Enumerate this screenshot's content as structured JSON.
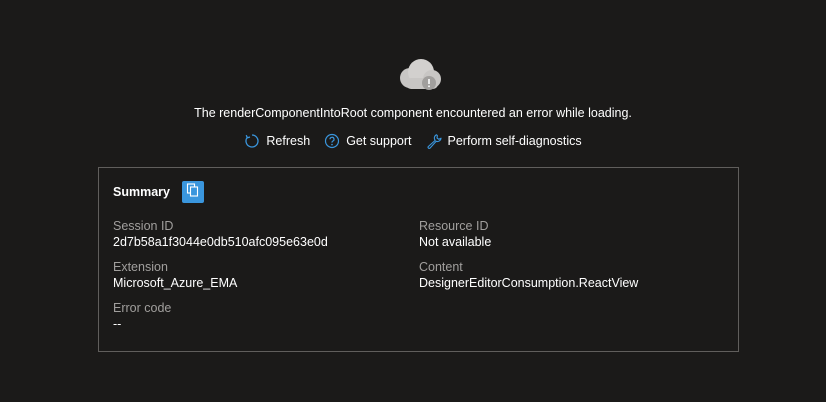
{
  "error": {
    "message": "The renderComponentIntoRoot component encountered an error while loading."
  },
  "actions": {
    "refresh_label": "Refresh",
    "support_label": "Get support",
    "diagnostics_label": "Perform self-diagnostics"
  },
  "summary": {
    "title": "Summary",
    "session_id_label": "Session ID",
    "session_id_value": "2d7b58a1f3044e0db510afc095e63e0d",
    "resource_id_label": "Resource ID",
    "resource_id_value": "Not available",
    "extension_label": "Extension",
    "extension_value": "Microsoft_Azure_EMA",
    "content_label": "Content",
    "content_value": "DesignerEditorConsumption.ReactView",
    "error_code_label": "Error code",
    "error_code_value": "--"
  },
  "icons": {
    "cloud": "cloud-error-icon",
    "refresh": "refresh-icon",
    "support": "help-circle-icon",
    "diagnostics": "wrench-icon",
    "copy": "copy-icon"
  },
  "colors": {
    "background": "#1b1a19",
    "accent": "#3a96dd",
    "border": "#605e5c",
    "muted_text": "#a19f9d"
  }
}
